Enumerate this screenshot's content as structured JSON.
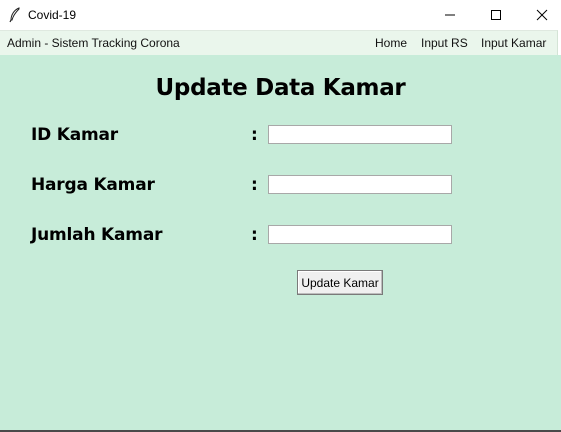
{
  "window": {
    "title": "Covid-19",
    "icons": {
      "app": "feather-icon",
      "minimize": "minimize-icon",
      "maximize": "maximize-icon",
      "close": "close-icon"
    }
  },
  "menubar": {
    "title": "Admin - Sistem Tracking Corona",
    "items": [
      "Home",
      "Input RS",
      "Input Kamar"
    ]
  },
  "form": {
    "heading": "Update Data Kamar",
    "fields": [
      {
        "label": "ID Kamar",
        "colon": ":",
        "value": ""
      },
      {
        "label": "Harga Kamar",
        "colon": ":",
        "value": ""
      },
      {
        "label": "Jumlah Kamar",
        "colon": ":",
        "value": ""
      }
    ],
    "submit_label": "Update Kamar"
  },
  "colors": {
    "background": "#c7ecd9",
    "menubar": "#eaf6ec"
  }
}
